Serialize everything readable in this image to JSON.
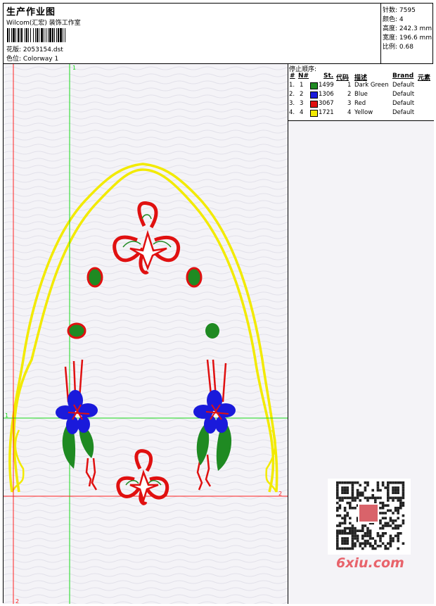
{
  "header": {
    "title": "生产作业图",
    "studio": "Wilcom(汇宏) 装饰工作室",
    "design_label": "花版:",
    "design_value": "2053154.dst",
    "colorway_label": "色位:",
    "colorway_value": "Colorway 1"
  },
  "stats": {
    "stitches_label": "针数:",
    "stitches_value": "7595",
    "colors_label": "颜色:",
    "colors_value": "4",
    "height_label": "高度:",
    "height_value": "242.3 mm",
    "width_label": "宽度:",
    "width_value": "196.6 mm",
    "scale_label": "比例:",
    "scale_value": "0.68"
  },
  "stop_sequence": {
    "title": "停止顺序:",
    "columns": [
      "#",
      "N#",
      "St.",
      "代码",
      "描述",
      "Brand",
      "元素"
    ],
    "rows": [
      {
        "index": "1.",
        "n": "1",
        "stitches": "1499",
        "code": "1",
        "description": "Dark Green",
        "brand": "Default"
      },
      {
        "index": "2.",
        "n": "2",
        "stitches": "1306",
        "code": "2",
        "description": "Blue",
        "brand": "Default"
      },
      {
        "index": "3.",
        "n": "3",
        "stitches": "3067",
        "code": "3",
        "description": "Red",
        "brand": "Default"
      },
      {
        "index": "4.",
        "n": "4",
        "stitches": "1721",
        "code": "4",
        "description": "Yellow",
        "brand": "Default"
      }
    ],
    "swatch_colors": [
      "#1f8a22",
      "#1a1adb",
      "#e01010",
      "#f2ea00"
    ]
  },
  "markers": {
    "v1": "1",
    "h1": "1",
    "h2": "2",
    "v2": "2"
  },
  "colors": {
    "dark_green": "#1f8a22",
    "blue": "#1a1adb",
    "red": "#e01010",
    "yellow": "#f2ea00",
    "guide_green": "#19d919",
    "guide_red": "#ff2020"
  },
  "watermark": {
    "text": "6xiu.com"
  }
}
